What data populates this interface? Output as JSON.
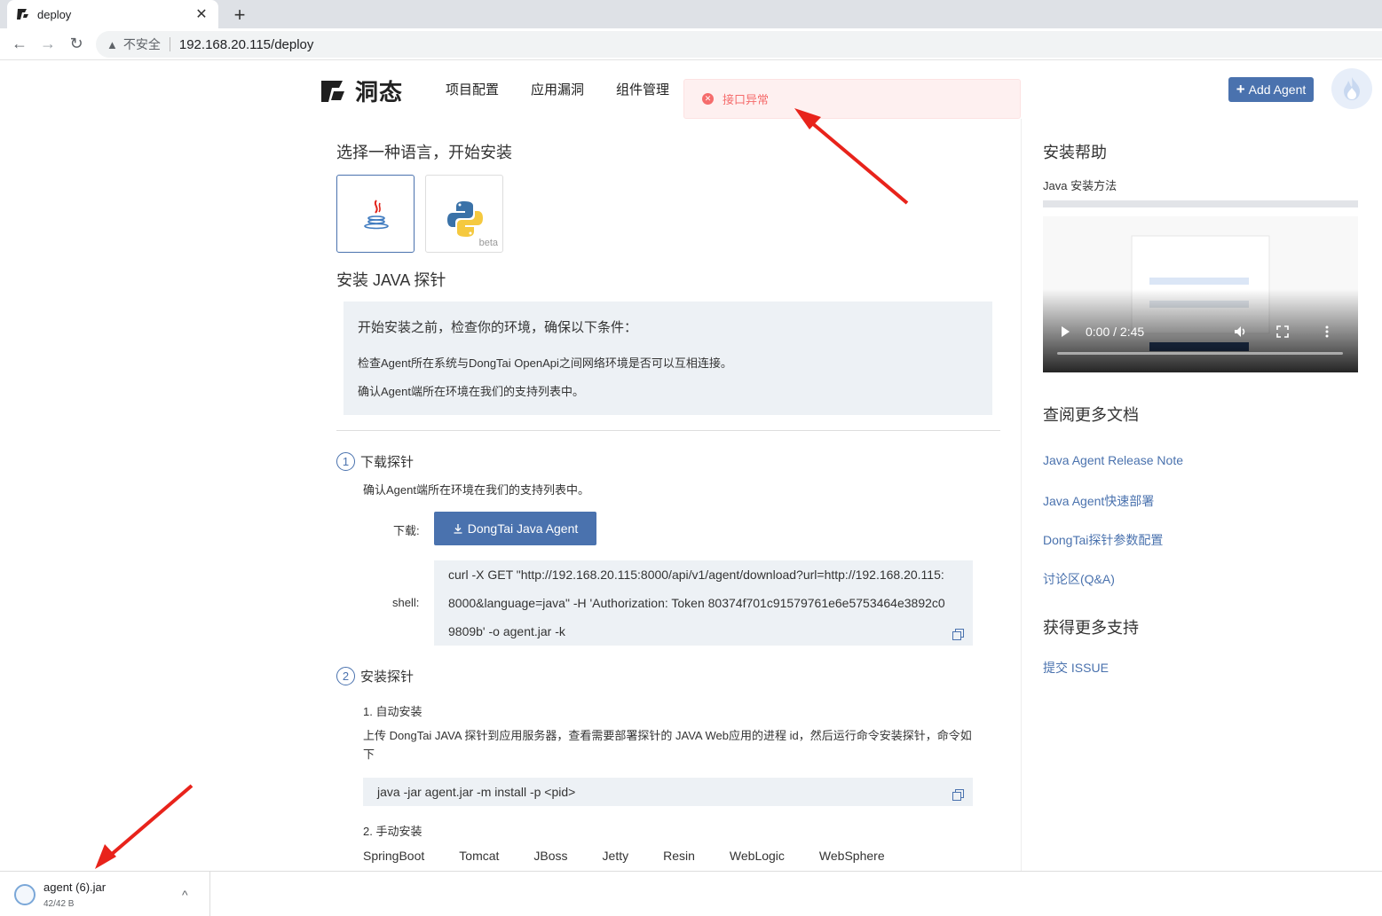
{
  "browser": {
    "tab_title": "deploy",
    "tab_close": "✕",
    "new_tab": "+",
    "back": "←",
    "forward": "→",
    "reload": "↻",
    "security_warning": "▲",
    "security_label": "不安全",
    "url": "192.168.20.115/deploy"
  },
  "header": {
    "logo_text": "洞态",
    "nav": [
      "项目配置",
      "应用漏洞",
      "组件管理"
    ],
    "add_agent": "Add Agent"
  },
  "toast": {
    "icon": "✕",
    "message": "接口异常"
  },
  "main": {
    "choose_title": "选择一种语言，开始安装",
    "languages": [
      {
        "name": "java",
        "badge": ""
      },
      {
        "name": "python",
        "badge": "beta"
      }
    ],
    "install_title": "安装 JAVA 探针",
    "notice": {
      "title": "开始安装之前，检查你的环境，确保以下条件：",
      "lines": [
        "检查Agent所在系统与DongTai OpenApi之间网络环境是否可以互相连接。",
        "确认Agent端所在环境在我们的支持列表中。"
      ]
    },
    "step1": {
      "num": "1",
      "title": "下载探针",
      "desc": "确认Agent端所在环境在我们的支持列表中。",
      "download_label": "下载:",
      "download_button": "DongTai Java Agent",
      "shell_label": "shell:",
      "shell_lines": [
        "curl -X GET \"http://192.168.20.115:8000/api/v1/agent/download?url=http://192.168.20.115:",
        "8000&language=java\" -H 'Authorization: Token 80374f701c91579761e6e5753464e3892c0",
        "9809b' -o agent.jar -k"
      ]
    },
    "step2": {
      "num": "2",
      "title": "安装探针",
      "auto_title": "1. 自动安装",
      "auto_desc": "上传 DongTai JAVA 探针到应用服务器，查看需要部署探针的 JAVA Web应用的进程 id，然后运行命令安装探针，命令如下",
      "auto_cmd": "java -jar agent.jar -m install -p <pid>",
      "manual_title": "2. 手动安装",
      "servers": [
        "SpringBoot",
        "Tomcat",
        "JBoss",
        "Jetty",
        "Resin",
        "WebLogic",
        "WebSphere"
      ]
    }
  },
  "sidebar": {
    "help_title": "安装帮助",
    "video_title": "Java 安装方法",
    "video_time": "0:00 / 2:45",
    "docs_title": "查阅更多文档",
    "doc_links": [
      "Java Agent Release Note",
      "Java Agent快速部署",
      "DongTai探针参数配置",
      "讨论区(Q&A)"
    ],
    "support_title": "获得更多支持",
    "support_link": "提交 ISSUE"
  },
  "downloads": {
    "file_name": "agent (6).jar",
    "file_size": "42/42 B",
    "chevron": "^"
  },
  "colors": {
    "accent": "#4a72ae",
    "error": "#f56c6c",
    "annotation": "#e8231b"
  }
}
